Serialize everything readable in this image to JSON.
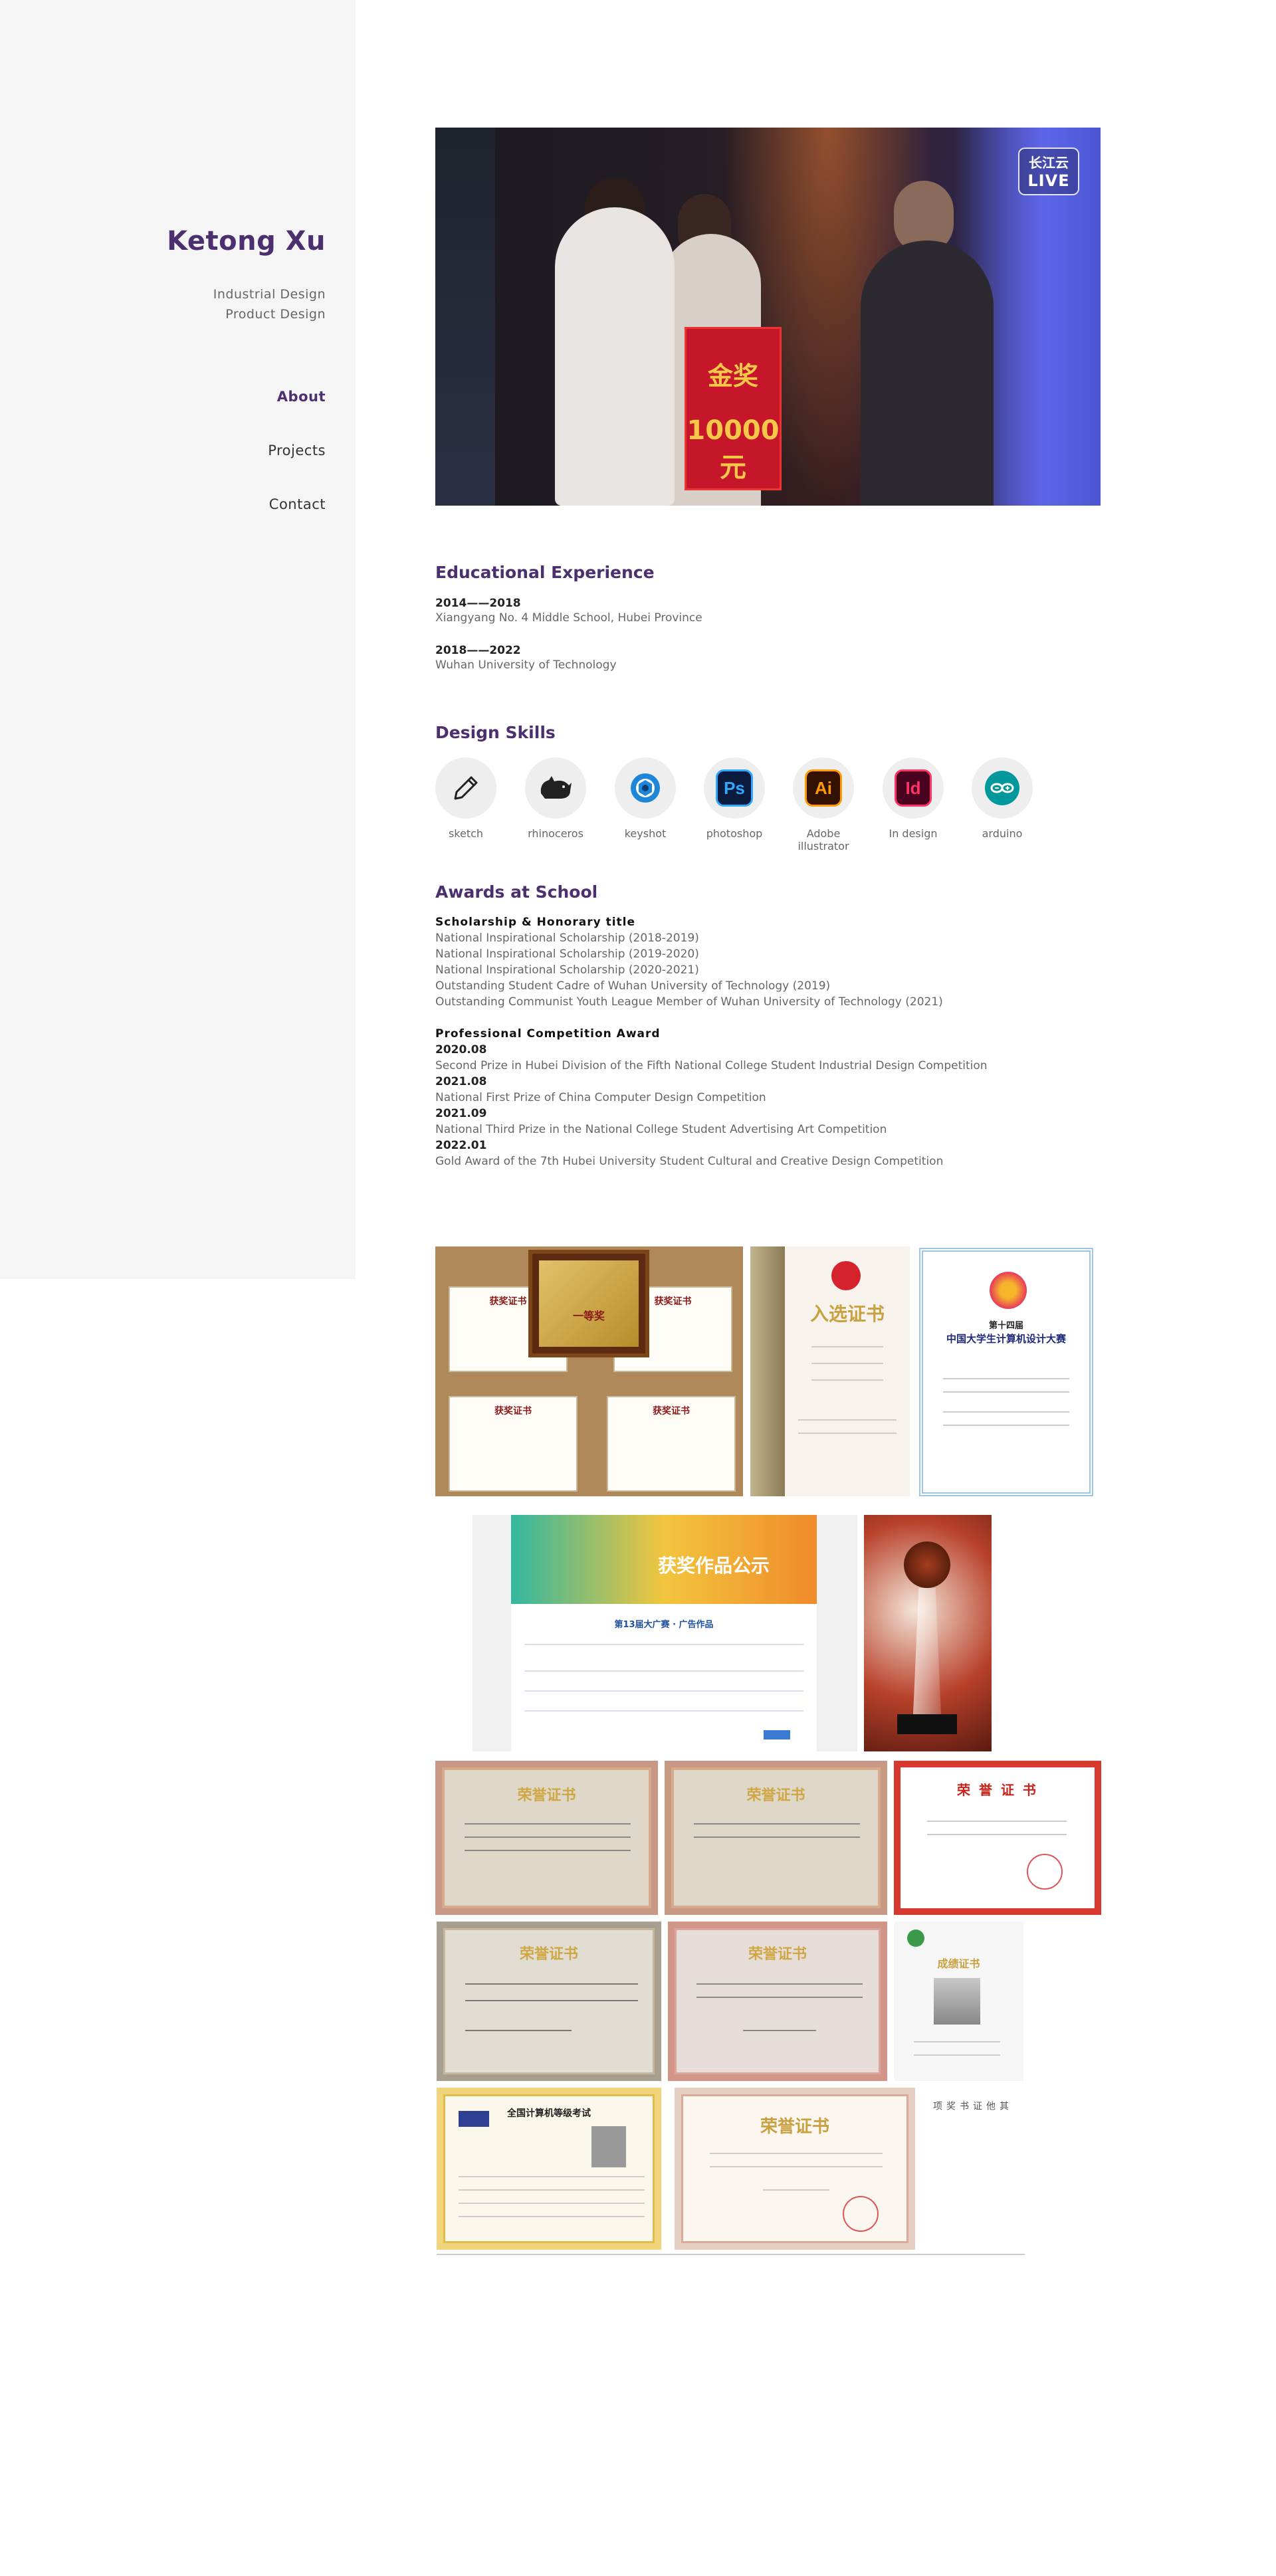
{
  "sidebar": {
    "name": "Ketong Xu",
    "subtitle_1": "Industrial Design",
    "subtitle_2": "Product Design",
    "nav": [
      {
        "label": "About"
      },
      {
        "label": "Projects"
      },
      {
        "label": "Contact"
      }
    ]
  },
  "hero": {
    "logo_line1": "长江云",
    "logo_line2": "LIVE",
    "sign_line1": "金奖",
    "sign_line2": "10000元"
  },
  "education": {
    "title": "Educational Experience",
    "items": [
      {
        "years": "2014——2018",
        "school": "Xiangyang No. 4 Middle School, Hubei Province"
      },
      {
        "years": "2018——2022",
        "school": "Wuhan University of Technology"
      }
    ]
  },
  "skills": {
    "title": "Design Skills",
    "items": [
      {
        "label": "sketch",
        "icon": "pencil-icon"
      },
      {
        "label": "rhinoceros",
        "icon": "rhino-icon"
      },
      {
        "label": "keyshot",
        "icon": "keyshot-icon"
      },
      {
        "label": "photoshop",
        "icon": "photoshop-icon",
        "abbr": "Ps"
      },
      {
        "label": "Adobe illustrator",
        "icon": "illustrator-icon",
        "abbr": "Ai"
      },
      {
        "label": "In design",
        "icon": "indesign-icon",
        "abbr": "Id"
      },
      {
        "label": "arduino",
        "icon": "arduino-icon"
      }
    ]
  },
  "awards": {
    "title": "Awards at School",
    "scholarship_title": "Scholarship & Honorary title",
    "scholarship": [
      "National Inspirational Scholarship (2018-2019)",
      "National Inspirational Scholarship (2019-2020)",
      "National Inspirational Scholarship (2020-2021)",
      "Outstanding Student Cadre of Wuhan University of Technology (2019)",
      "Outstanding Communist Youth League Member of Wuhan University of Technology (2021)"
    ],
    "competition_title": "Professional Competition Award",
    "competition": [
      {
        "date": "2020.08",
        "text": "Second Prize in Hubei Division of the Fifth National College Student Industrial Design Competition"
      },
      {
        "date": "2021.08",
        "text": "National First Prize of China Computer Design Competition"
      },
      {
        "date": "2021.09",
        "text": "National Third Prize in the National College Student Advertising Art Competition"
      },
      {
        "date": "2022.01",
        "text": "Gold Award of the 7th Hubei University Student Cultural and Creative Design Competition"
      }
    ]
  },
  "gallery": {
    "cert_a": "获奖证书",
    "cert_b": "一等奖",
    "cert_c": "入选证书",
    "cert_d": "第十四届",
    "cert_d2": "中国大学生计算机设计大赛",
    "banner_title": "获奖作品公示",
    "banner_sub": "第13届大广赛 · 广告作品",
    "honor_1": "荣誉证书",
    "honor_2": "荣誉证书",
    "honor_3": "荣 誉 证 书",
    "honor_4": "荣誉证书",
    "honor_5": "荣誉证书",
    "honor_6": "成绩证书",
    "honor_7": "全国计算机等级考试",
    "honor_8": "荣誉证书",
    "side_note": "其他证书奖项"
  },
  "colors": {
    "accent": "#4b2f6e",
    "sidebar_bg": "#f5f5f5"
  }
}
